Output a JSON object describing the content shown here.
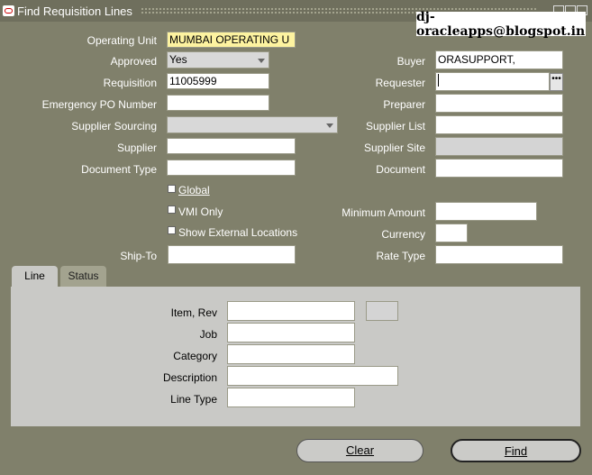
{
  "window": {
    "title": "Find Requisition Lines",
    "watermark": "dj-oracleapps@blogspot.in"
  },
  "form": {
    "operating_unit": {
      "label": "Operating Unit",
      "value": "MUMBAI OPERATING U"
    },
    "approved": {
      "label": "Approved",
      "value": "Yes"
    },
    "requisition": {
      "label": "Requisition",
      "value": "11005999"
    },
    "emergency_po": {
      "label": "Emergency PO Number",
      "value": ""
    },
    "supplier_sourcing": {
      "label": "Supplier Sourcing",
      "value": ""
    },
    "supplier": {
      "label": "Supplier",
      "value": ""
    },
    "document_type": {
      "label": "Document Type",
      "value": ""
    },
    "global": {
      "label": "Global",
      "checked": false
    },
    "vmi_only": {
      "label": "VMI Only",
      "checked": false
    },
    "show_external": {
      "label": "Show External Locations",
      "checked": false
    },
    "ship_to": {
      "label": "Ship-To",
      "value": ""
    },
    "buyer": {
      "label": "Buyer",
      "value": "ORASUPPORT,"
    },
    "requester": {
      "label": "Requester",
      "value": ""
    },
    "preparer": {
      "label": "Preparer",
      "value": ""
    },
    "supplier_list": {
      "label": "Supplier List",
      "value": ""
    },
    "supplier_site": {
      "label": "Supplier Site",
      "value": ""
    },
    "document": {
      "label": "Document",
      "value": ""
    },
    "minimum_amount": {
      "label": "Minimum Amount",
      "value": ""
    },
    "currency": {
      "label": "Currency",
      "value": ""
    },
    "rate_type": {
      "label": "Rate Type",
      "value": ""
    }
  },
  "tabs": [
    {
      "label": "Line",
      "active": true
    },
    {
      "label": "Status",
      "active": false
    }
  ],
  "line_panel": {
    "item_rev": {
      "label": "Item, Rev",
      "value": "",
      "rev": ""
    },
    "job": {
      "label": "Job",
      "value": ""
    },
    "category": {
      "label": "Category",
      "value": ""
    },
    "description": {
      "label": "Description",
      "value": ""
    },
    "line_type": {
      "label": "Line Type",
      "value": ""
    }
  },
  "buttons": {
    "clear": "Clear",
    "find": "Find"
  },
  "colors": {
    "background": "#80806b",
    "panel": "#c9c9c6",
    "required_field": "#fdf3a0"
  }
}
